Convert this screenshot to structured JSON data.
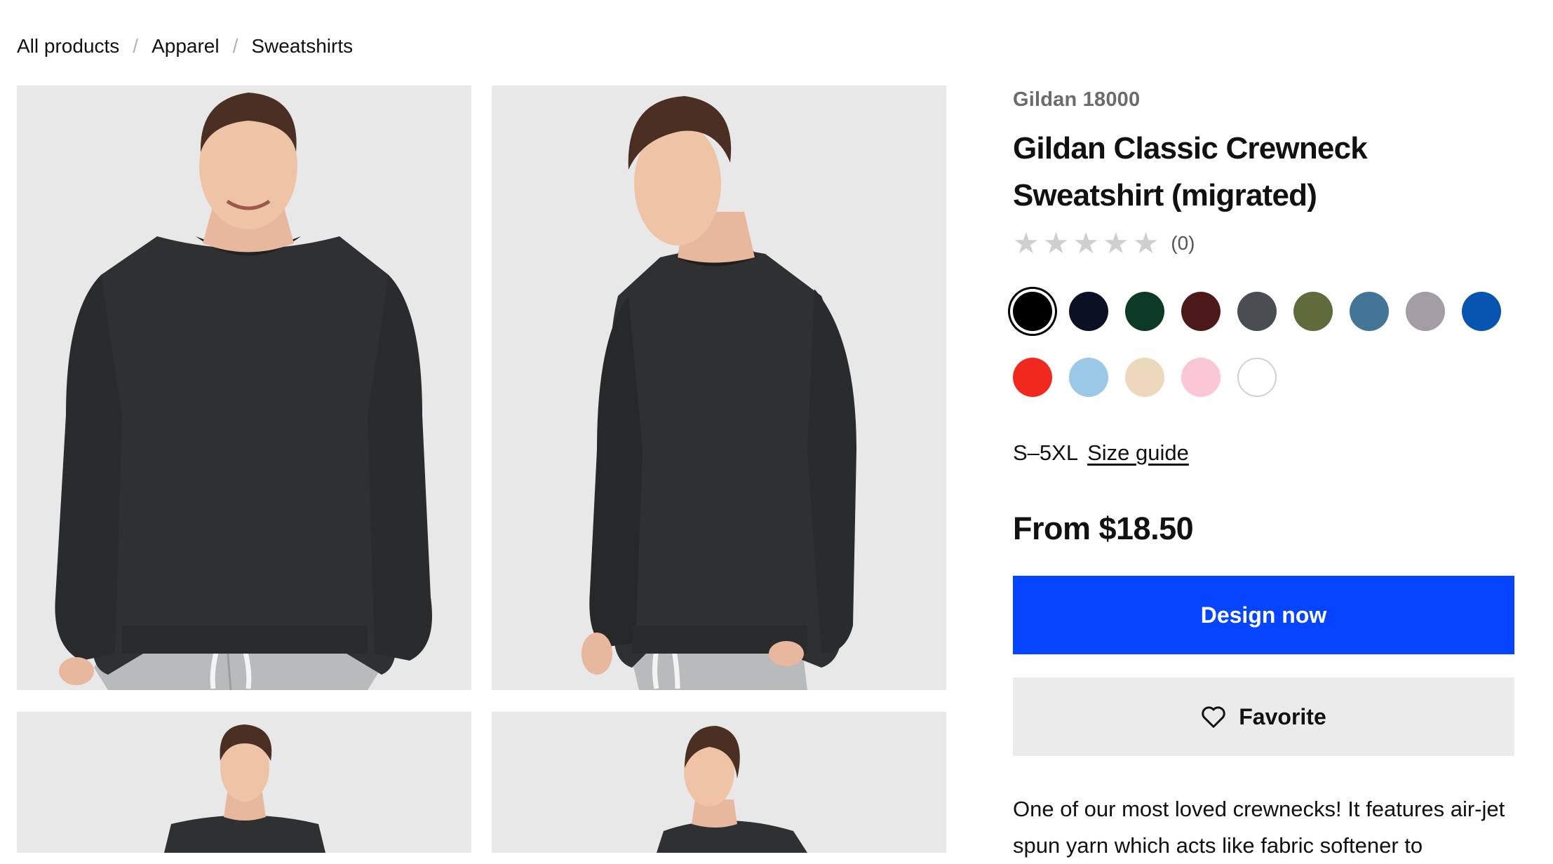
{
  "breadcrumb": {
    "items": [
      "All products",
      "Apparel",
      "Sweatshirts"
    ],
    "separator": "/"
  },
  "gallery": {
    "images": [
      {
        "view": "front"
      },
      {
        "view": "side"
      },
      {
        "view": "front-zoomed-out"
      },
      {
        "view": "back"
      }
    ],
    "background": "#e8e8e8",
    "garment_color": "#2f3031"
  },
  "product": {
    "sku": "Gildan 18000",
    "title": "Gildan Classic Crewneck Sweatshirt (migrated)",
    "rating": {
      "stars": 5,
      "value": 0,
      "count_label": "(0)"
    },
    "colors": [
      {
        "hex": "#000000",
        "selected": true
      },
      {
        "hex": "#0b1024",
        "selected": false
      },
      {
        "hex": "#0d3a24",
        "selected": false
      },
      {
        "hex": "#4d1a1c",
        "selected": false
      },
      {
        "hex": "#4a4d52",
        "selected": false
      },
      {
        "hex": "#5f6b3a",
        "selected": false
      },
      {
        "hex": "#437597",
        "selected": false
      },
      {
        "hex": "#a39ea5",
        "selected": false
      },
      {
        "hex": "#0753b0",
        "selected": false
      },
      {
        "hex": "#f0281e",
        "selected": false
      },
      {
        "hex": "#9ac8e6",
        "selected": false
      },
      {
        "hex": "#ecd8bb",
        "selected": false
      },
      {
        "hex": "#fac5d4",
        "selected": false
      },
      {
        "hex": "#ffffff",
        "selected": false
      }
    ],
    "sizes": "S–5XL",
    "size_guide_label": "Size guide",
    "price_label": "From $18.50",
    "design_button_label": "Design now",
    "favorite_button_label": "Favorite",
    "description": "One of our most loved crewnecks! It features air-jet spun yarn which acts like fabric softener to"
  },
  "colors": {
    "accent": "#0545ff",
    "star_empty": "#cfcfcf",
    "favorite_bg": "#ebebeb"
  }
}
